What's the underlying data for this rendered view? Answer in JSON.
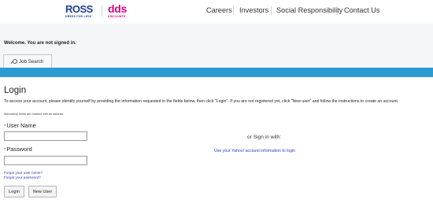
{
  "header": {
    "ross_brand": "ROSS",
    "ross_tagline": "DRESS FOR LESS",
    "dds_brand": "dds",
    "dds_tagline": "DISCOUNTS",
    "nav": [
      {
        "label": "Careers"
      },
      {
        "label": "Investors"
      },
      {
        "label": "Social Responsibility"
      },
      {
        "label": "Contact Us"
      }
    ]
  },
  "status": {
    "welcome": "Welcome. You are not signed in."
  },
  "tabs": [
    {
      "label": "Job Search",
      "icon": "search-icon"
    }
  ],
  "login": {
    "title": "Login",
    "intro": "To access your account, please identify yourself by providing the information requested in the fields below, then click \"Login\". If you are not registered yet, click \"New user\" and follow the instructions to create an account.",
    "mandatory_note": "Mandatory fields are marked with an asterisk.",
    "required_marker": "*",
    "username_label": "User Name",
    "username_value": "",
    "password_label": "Password",
    "password_value": "",
    "forgot_username": "Forgot your user name?",
    "forgot_password": "Forgot your password?",
    "login_button": "Login",
    "new_user_button": "New User"
  },
  "alt_signin": {
    "or_text": "or Sign in with:",
    "yahoo_link": "Use your Yahoo! account information to login"
  },
  "colors": {
    "accent_bar": "#2d9ad2",
    "ross_blue": "#1f3f8f",
    "dds_pink": "#e3007d",
    "link": "#2a3fb0",
    "required": "#c8102e"
  }
}
